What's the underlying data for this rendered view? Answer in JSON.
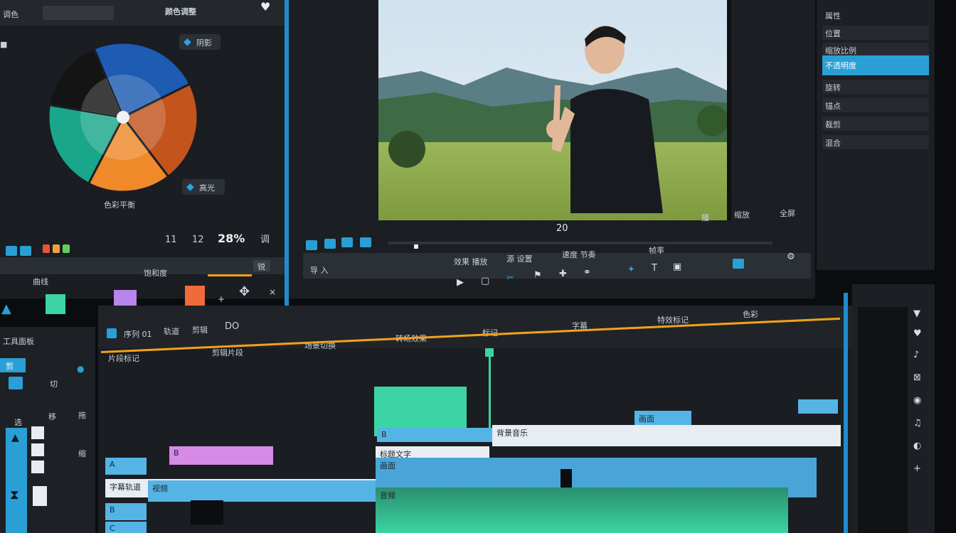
{
  "colors": {
    "accent_blue": "#2a9fd6",
    "accent_green": "#3bd4a2",
    "playhead_orange": "#f3a21b",
    "clip_pink": "#d68be6",
    "clip_light": "#e7edf2",
    "panel_bg": "#15181c"
  },
  "color_panel": {
    "title": "颜色调整",
    "top_left_label": "调色",
    "callout_top": "阴影",
    "callout_bottom": "高光",
    "wheel_caption": "色彩平衡",
    "readout_1": "11",
    "readout_2": "12",
    "readout_3": "28%",
    "readout_4": "调",
    "bar_label_left": "曲线",
    "bar_label_center": "饱和度",
    "bar_label_right": "锐",
    "swatches": [
      "#3bd4a2",
      "#b884ee",
      "#f06a3a"
    ]
  },
  "preview": {
    "timecode": "20",
    "right_labels": [
      "播",
      "缩放",
      "全屏"
    ],
    "toolbar_text": [
      "效果 播放",
      "源 设置",
      "速度 节奏",
      "帧率"
    ],
    "toolbar_left": "导 入",
    "scene_caption": ""
  },
  "inspector": {
    "title": "属性",
    "rows": [
      "位置",
      "缩放比例",
      "不透明度",
      "旋转",
      "锚点",
      "裁剪",
      "混合"
    ]
  },
  "timeline": {
    "header_left": "序列 01",
    "tab_1": "轨道",
    "tab_2": "剪辑",
    "tab_3": "DO",
    "markers": [
      "片段标记",
      "剪辑片段",
      "场景切换",
      "转场效果",
      "标记",
      "字幕",
      "特效标记",
      "色彩"
    ],
    "clips": {
      "pink": "B",
      "blue_1": "B",
      "title_center": "标题文字",
      "light_1": "字幕轨道",
      "light_2": "背景音乐",
      "blue_label": "视频",
      "blue_right": "画面",
      "audio": "音频",
      "track_a": "A",
      "track_b": "B",
      "track_c": "C"
    }
  },
  "left_tools": {
    "title": "工具面板",
    "button_1": "剪",
    "labels": [
      "切",
      "选",
      "移",
      "拖",
      "缩"
    ]
  },
  "chart_data": {
    "type": "pie",
    "title": "",
    "values": [
      24,
      22,
      18,
      20,
      16
    ],
    "series": [
      {
        "name": "",
        "values": [
          24,
          22,
          18,
          20,
          16
        ]
      }
    ],
    "slice_colors": [
      "#1e5bb3",
      "#c3541c",
      "#f0892a",
      "#1aa68a",
      "#141414"
    ]
  }
}
